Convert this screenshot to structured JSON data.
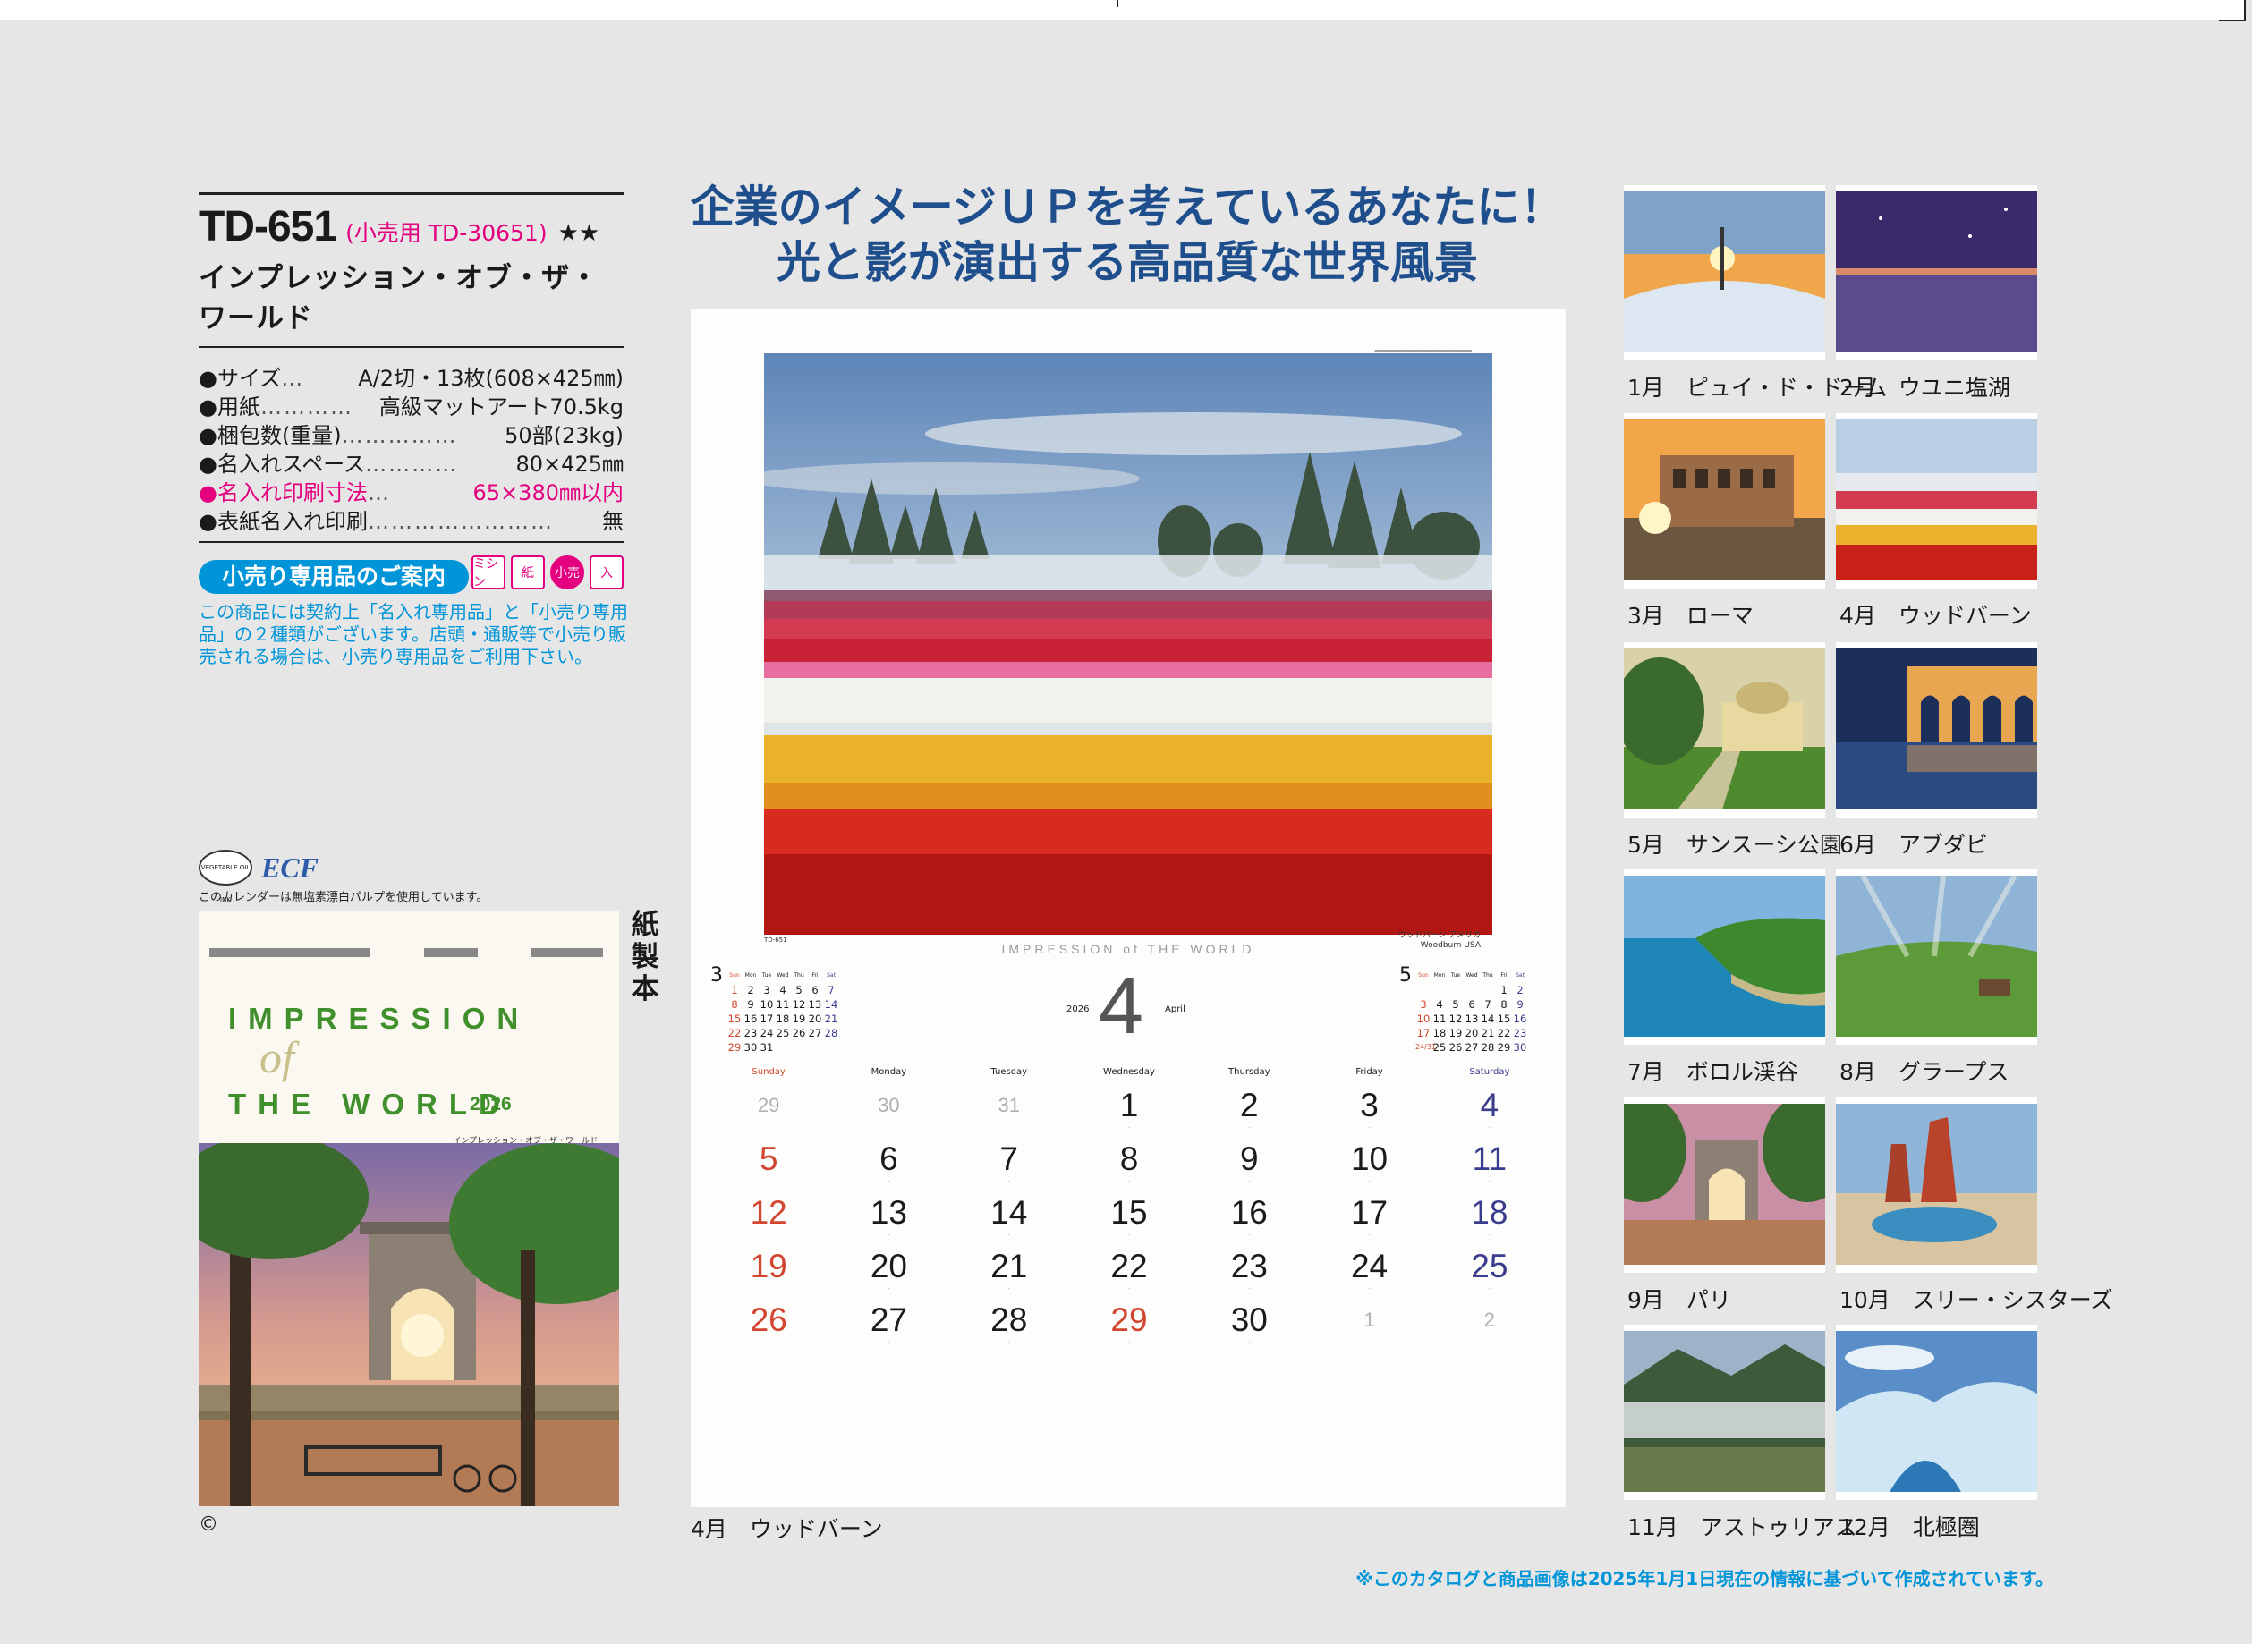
{
  "product": {
    "code": "TD-651",
    "retail_code": "(小売用 TD-30651)",
    "stars": "★★",
    "title": "インプレッション・オブ・ザ・ワールド"
  },
  "specs": [
    {
      "key": "●サイズ",
      "dots": "…",
      "value": "A/2切・13枚(608×425㎜)",
      "pink": false
    },
    {
      "key": "●用紙",
      "dots": "…………",
      "value": "高級マットアート70.5kg",
      "pink": false
    },
    {
      "key": "●梱包数(重量)",
      "dots": "……………",
      "value": "50部(23kg)",
      "pink": false
    },
    {
      "key": "●名入れスペース",
      "dots": "…………",
      "value": "80×425㎜",
      "pink": false
    },
    {
      "key": "●名入れ印刷寸法",
      "dots": "…",
      "value": "65×380㎜以内",
      "pink": true
    },
    {
      "key": "●表紙名入れ印刷",
      "dots": "……………………",
      "value": "無",
      "pink": false
    }
  ],
  "badges": [
    "ミシン",
    "紙",
    "小売",
    "入"
  ],
  "retail_notice": {
    "title": "小売り専用品のご案内",
    "text": "この商品には契約上「名入れ専用品」と「小売り専用品」の２種類がございます。店頭・通販等で小売り販売される場合は、小売り専用品をご利用下さい。"
  },
  "eco": {
    "veg_label": "VEGETABLE OIL INK",
    "ecf_label": "ECF",
    "pulp_note": "このカレンダーは無塩素漂白パルプを使用しています。"
  },
  "cover": {
    "title_line1": "IMPRESSION",
    "title_of": "of",
    "title_line2": "THE WORLD",
    "year": "2026",
    "subtitle": "インプレッション・オブ・ザ・ワールド"
  },
  "binding_label": "紙製本",
  "copyright": "©",
  "headline": {
    "line1": "企業のイメージＵＰを考えているあなたに！",
    "line2": "光と影が演出する高品質な世界風景"
  },
  "calendar": {
    "year": "2026",
    "month": "4",
    "month_en": "April",
    "brand": "IMPRESSION of THE WORLD",
    "code": "TD-651",
    "photo_caption_jp": "ウッドバーン アメリカ",
    "photo_caption_en": "Woodburn USA",
    "weekdays": [
      "Sunday",
      "Monday",
      "Tuesday",
      "Wednesday",
      "Thursday",
      "Friday",
      "Saturday"
    ],
    "mini_prev": {
      "month": "3",
      "headers": [
        "Sun",
        "Mon",
        "Tue",
        "Wed",
        "Thu",
        "Fri",
        "Sat"
      ],
      "rows": [
        [
          "1",
          "2",
          "3",
          "4",
          "5",
          "6",
          "7"
        ],
        [
          "8",
          "9",
          "10",
          "11",
          "12",
          "13",
          "14"
        ],
        [
          "15",
          "16",
          "17",
          "18",
          "19",
          "20",
          "21"
        ],
        [
          "22",
          "23",
          "24",
          "25",
          "26",
          "27",
          "28"
        ],
        [
          "29",
          "30",
          "31",
          "",
          "",
          "",
          ""
        ]
      ]
    },
    "mini_next": {
      "month": "5",
      "headers": [
        "Sun",
        "Mon",
        "Tue",
        "Wed",
        "Thu",
        "Fri",
        "Sat"
      ],
      "rows": [
        [
          "",
          "",
          "",
          "",
          "",
          "1",
          "2"
        ],
        [
          "3",
          "4",
          "5",
          "6",
          "7",
          "8",
          "9"
        ],
        [
          "10",
          "11",
          "12",
          "13",
          "14",
          "15",
          "16"
        ],
        [
          "17",
          "18",
          "19",
          "20",
          "21",
          "22",
          "23"
        ],
        [
          "24/31",
          "25",
          "26",
          "27",
          "28",
          "29",
          "30"
        ]
      ]
    },
    "days": [
      {
        "d": "29",
        "t": "mut"
      },
      {
        "d": "30",
        "t": "mut"
      },
      {
        "d": "31",
        "t": "mut"
      },
      {
        "d": "1",
        "t": ""
      },
      {
        "d": "2",
        "t": ""
      },
      {
        "d": "3",
        "t": ""
      },
      {
        "d": "4",
        "t": "sat"
      },
      {
        "d": "5",
        "t": "sun"
      },
      {
        "d": "6",
        "t": ""
      },
      {
        "d": "7",
        "t": ""
      },
      {
        "d": "8",
        "t": ""
      },
      {
        "d": "9",
        "t": ""
      },
      {
        "d": "10",
        "t": ""
      },
      {
        "d": "11",
        "t": "sat"
      },
      {
        "d": "12",
        "t": "sun"
      },
      {
        "d": "13",
        "t": ""
      },
      {
        "d": "14",
        "t": ""
      },
      {
        "d": "15",
        "t": ""
      },
      {
        "d": "16",
        "t": ""
      },
      {
        "d": "17",
        "t": ""
      },
      {
        "d": "18",
        "t": "sat"
      },
      {
        "d": "19",
        "t": "sun"
      },
      {
        "d": "20",
        "t": ""
      },
      {
        "d": "21",
        "t": ""
      },
      {
        "d": "22",
        "t": ""
      },
      {
        "d": "23",
        "t": ""
      },
      {
        "d": "24",
        "t": ""
      },
      {
        "d": "25",
        "t": "sat"
      },
      {
        "d": "26",
        "t": "sun"
      },
      {
        "d": "27",
        "t": ""
      },
      {
        "d": "28",
        "t": ""
      },
      {
        "d": "29",
        "t": "sun"
      },
      {
        "d": "30",
        "t": ""
      },
      {
        "d": "1",
        "t": "mut"
      },
      {
        "d": "2",
        "t": "mut"
      }
    ]
  },
  "calendar_label": "4月　ウッドバーン",
  "thumbnails": [
    {
      "label": "1月　ピュイ・ド・ドーム",
      "scene": "sunset-snow"
    },
    {
      "label": "2月　ウユニ塩湖",
      "scene": "night-lake"
    },
    {
      "label": "3月　ローマ",
      "scene": "colosseum"
    },
    {
      "label": "4月　ウッドバーン",
      "scene": "tulips"
    },
    {
      "label": "5月　サンスーシ公園",
      "scene": "park"
    },
    {
      "label": "6月　アブダビ",
      "scene": "arches"
    },
    {
      "label": "7月　ボロル渓谷",
      "scene": "coast"
    },
    {
      "label": "8月　グラープス",
      "scene": "meadow"
    },
    {
      "label": "9月　パリ",
      "scene": "paris"
    },
    {
      "label": "10月　スリー・シスターズ",
      "scene": "rocks"
    },
    {
      "label": "11月　アストゥリアス",
      "scene": "mist-valley"
    },
    {
      "label": "12月　北極圏",
      "scene": "ice"
    }
  ],
  "footnote": "※このカタログと商品画像は2025年1月1日現在の情報に基づいて作成されています。",
  "colors": {
    "accent_blue": "#0095d9",
    "pink": "#e4007f",
    "headline_navy": "#1f4e8c",
    "sunday_red": "#d2452f",
    "saturday_navy": "#3a3c8e"
  }
}
